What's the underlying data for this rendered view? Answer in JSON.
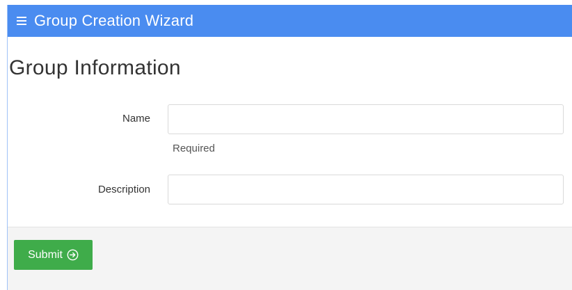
{
  "header": {
    "title": "Group Creation Wizard",
    "menu_icon": "hamburger-menu-icon",
    "background": "#4a8cf0"
  },
  "form": {
    "section_title": "Group Information",
    "name": {
      "label": "Name",
      "value": "",
      "help": "Required"
    },
    "description": {
      "label": "Description",
      "value": ""
    }
  },
  "footer": {
    "submit_label": "Submit",
    "submit_icon": "circle-arrow-right-icon",
    "submit_color": "#3fac4a"
  }
}
